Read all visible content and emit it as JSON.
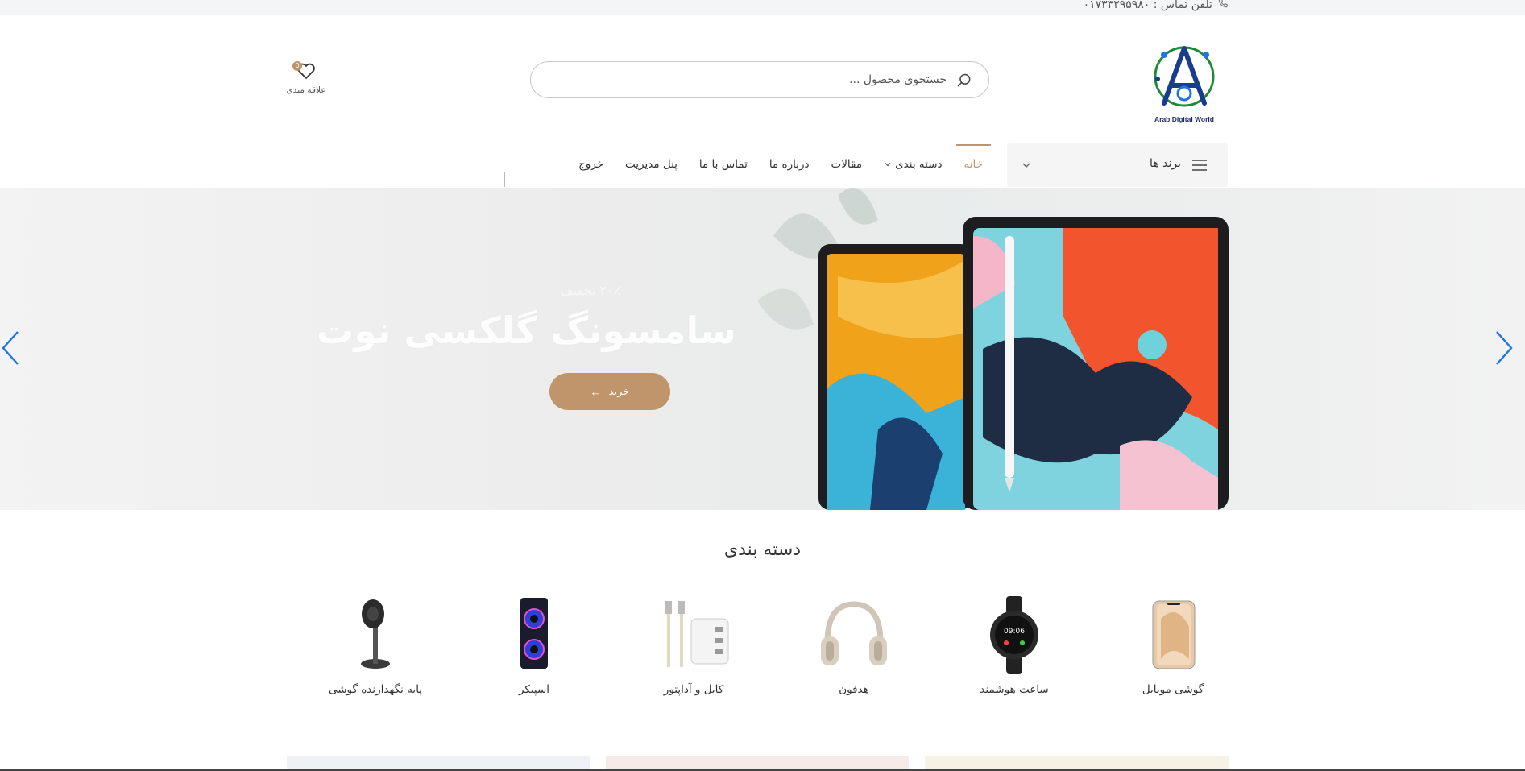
{
  "topbar": {
    "phone_text": "تلفن تماس : ۰۱۷۳۳۲۹۵۹۸۰"
  },
  "header": {
    "logo_text": "Arab Digital World",
    "search_placeholder": "جستجوی محصول ...",
    "wishlist_label": "علاقه مندی",
    "wishlist_count": "0"
  },
  "nav": {
    "brands_label": "برند ها",
    "items": [
      {
        "label": "خانه",
        "active": true
      },
      {
        "label": "دسته بندی",
        "dropdown": true
      },
      {
        "label": "مقالات"
      },
      {
        "label": "درباره ما"
      },
      {
        "label": "تماس با ما"
      },
      {
        "label": "پنل مدیریت"
      },
      {
        "label": "خروج"
      }
    ]
  },
  "hero": {
    "subtitle": "۲۰٪ تخفیف",
    "title": "سامسونگ گلکسی نوت",
    "button_label": "خرید"
  },
  "categories": {
    "title": "دسته بندی",
    "items": [
      {
        "label": "گوشی موبایل",
        "icon": "phone-image"
      },
      {
        "label": "ساعت هوشمند",
        "icon": "smartwatch-image"
      },
      {
        "label": "هدفون",
        "icon": "headphones-image"
      },
      {
        "label": "کابل و آداپتور",
        "icon": "cable-adapter-image"
      },
      {
        "label": "اسپیکر",
        "icon": "speaker-image"
      },
      {
        "label": "پایه نگهدارنده گوشی",
        "icon": "phone-stand-image"
      }
    ]
  },
  "colors": {
    "accent": "#c0956b",
    "arrow": "#1e73e8"
  }
}
